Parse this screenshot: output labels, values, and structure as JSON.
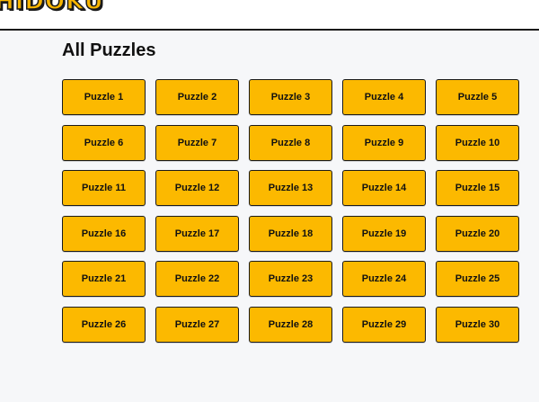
{
  "header": {
    "logo_text": "HIDOKU"
  },
  "main": {
    "title": "All Puzzles",
    "puzzles": [
      "Puzzle 1",
      "Puzzle 2",
      "Puzzle 3",
      "Puzzle 4",
      "Puzzle 5",
      "Puzzle 6",
      "Puzzle 7",
      "Puzzle 8",
      "Puzzle 9",
      "Puzzle 10",
      "Puzzle 11",
      "Puzzle 12",
      "Puzzle 13",
      "Puzzle 14",
      "Puzzle 15",
      "Puzzle 16",
      "Puzzle 17",
      "Puzzle 18",
      "Puzzle 19",
      "Puzzle 20",
      "Puzzle 21",
      "Puzzle 22",
      "Puzzle 23",
      "Puzzle 24",
      "Puzzle 25",
      "Puzzle 26",
      "Puzzle 27",
      "Puzzle 28",
      "Puzzle 29",
      "Puzzle 30"
    ]
  },
  "colors": {
    "accent": "#fcb900",
    "border": "#1a1a1a",
    "background": "#f6f7f9"
  }
}
